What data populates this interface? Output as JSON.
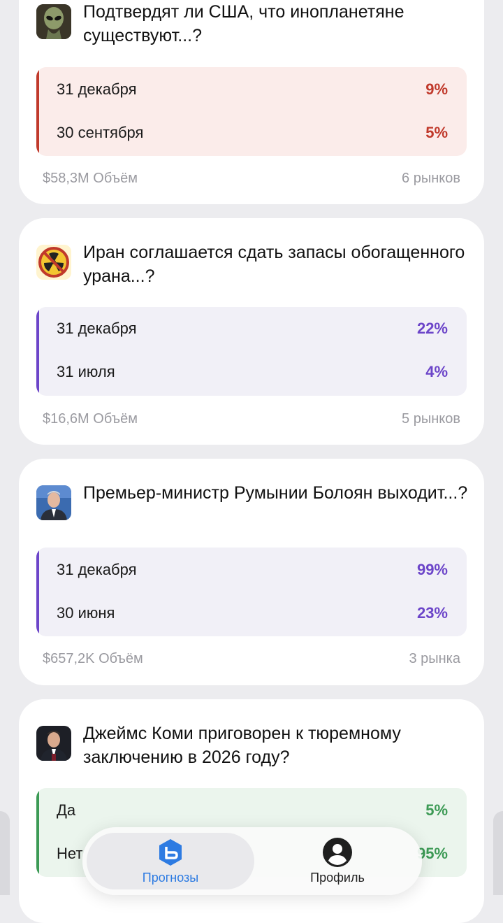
{
  "markets": [
    {
      "title": "Подтвердят ли США, что инопланетяне существуют...?",
      "thumb_icon": "alien-icon",
      "theme_color": "#c0392b",
      "options": [
        {
          "label": "31 декабря",
          "percent": "9%"
        },
        {
          "label": "30 сентября",
          "percent": "5%"
        }
      ],
      "volume": "$58,3M Объём",
      "markets_count": "6 рынков"
    },
    {
      "title": "Иран соглашается сдать запасы обогащенного урана...?",
      "thumb_icon": "no-radiation-icon",
      "theme_color": "#6c45c9",
      "options": [
        {
          "label": "31 декабря",
          "percent": "22%"
        },
        {
          "label": "31 июля",
          "percent": "4%"
        }
      ],
      "volume": "$16,6M Объём",
      "markets_count": "5 рынков"
    },
    {
      "title": "Премьер-министр Румынии Болоян выходит...?",
      "thumb_icon": "person-photo-icon",
      "theme_color": "#6c45c9",
      "options": [
        {
          "label": "31 декабря",
          "percent": "99%"
        },
        {
          "label": "30 июня",
          "percent": "23%"
        }
      ],
      "volume": "$657,2K Объём",
      "markets_count": "3 рынка"
    },
    {
      "title": "Джеймс Коми приговорен к тюремному заключению в 2026 году?",
      "thumb_icon": "person-photo-icon",
      "theme_color": "#3c9a55",
      "options": [
        {
          "label": "Да",
          "percent": "5%"
        },
        {
          "label": "Нет",
          "percent": "95%"
        }
      ]
    }
  ],
  "nav": {
    "items": [
      {
        "label": "Прогнозы",
        "icon": "forecast-icon",
        "active": true
      },
      {
        "label": "Профиль",
        "icon": "profile-icon",
        "active": false
      }
    ],
    "active_color": "#2d7be2"
  }
}
